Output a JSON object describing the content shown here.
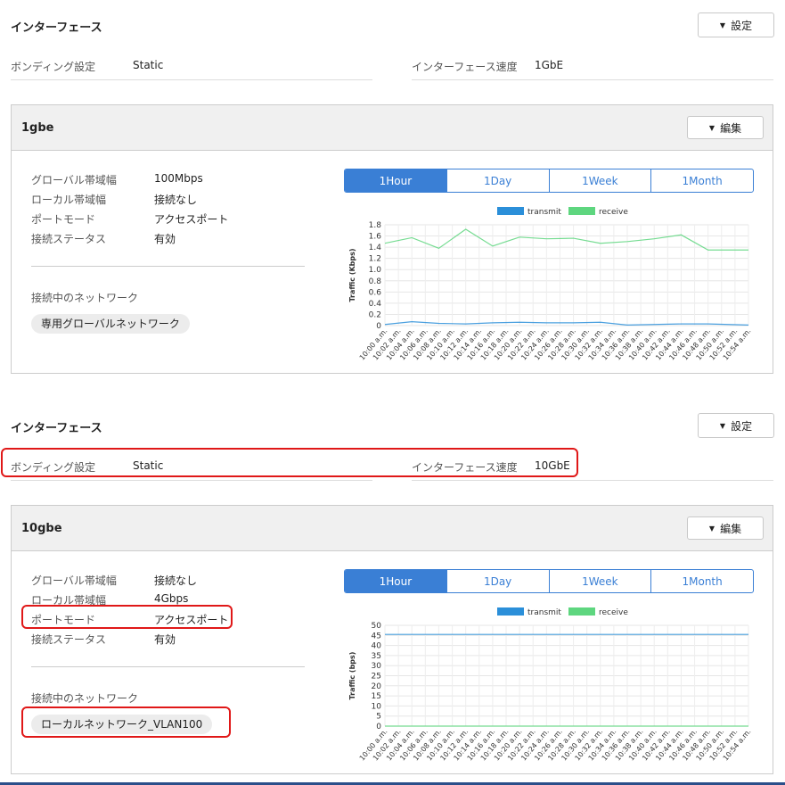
{
  "section1": {
    "title": "インターフェース",
    "settings_button": "設定",
    "bonding_label": "ボンディング設定",
    "bonding_value": "Static",
    "speed_label": "インターフェース速度",
    "speed_value": "1GbE"
  },
  "panel1": {
    "title": "1gbe",
    "edit_button": "編集",
    "rows": [
      {
        "label": "グローバル帯域幅",
        "value": "100Mbps"
      },
      {
        "label": "ローカル帯域幅",
        "value": "接続なし"
      },
      {
        "label": "ポートモード",
        "value": "アクセスポート"
      },
      {
        "label": "接続ステータス",
        "value": "有効"
      }
    ],
    "networks_label": "接続中のネットワーク",
    "network_chip": "専用グローバルネットワーク",
    "tabs": [
      "1Hour",
      "1Day",
      "1Week",
      "1Month"
    ],
    "active_tab": "1Hour"
  },
  "section2": {
    "title": "インターフェース",
    "settings_button": "設定",
    "bonding_label": "ボンディング設定",
    "bonding_value": "Static",
    "speed_label": "インターフェース速度",
    "speed_value": "10GbE"
  },
  "panel2": {
    "title": "10gbe",
    "edit_button": "編集",
    "rows": [
      {
        "label": "グローバル帯域幅",
        "value": "接続なし"
      },
      {
        "label": "ローカル帯域幅",
        "value": "4Gbps"
      },
      {
        "label": "ポートモード",
        "value": "アクセスポート"
      },
      {
        "label": "接続ステータス",
        "value": "有効"
      }
    ],
    "networks_label": "接続中のネットワーク",
    "network_chip": "ローカルネットワーク_VLAN100",
    "tabs": [
      "1Hour",
      "1Day",
      "1Week",
      "1Month"
    ],
    "active_tab": "1Hour"
  },
  "colors": {
    "accent": "#3a7fd5",
    "transmit": "#2b8fd9",
    "receive": "#5ed67f",
    "highlight": "#e01818"
  },
  "chart_data": [
    {
      "type": "line",
      "ylabel": "Traffic (Kbps)",
      "ylim": [
        0,
        1.8
      ],
      "yticks": [
        "0",
        "0.2",
        "0.4",
        "0.6",
        "0.8",
        "1.0",
        "1.2",
        "1.4",
        "1.6",
        "1.8"
      ],
      "x": [
        "10:00 a.m.",
        "10:02 a.m.",
        "10:04 a.m.",
        "10:06 a.m.",
        "10:08 a.m.",
        "10:10 a.m.",
        "10:12 a.m.",
        "10:14 a.m.",
        "10:16 a.m.",
        "10:18 a.m.",
        "10:20 a.m.",
        "10:22 a.m.",
        "10:24 a.m.",
        "10:26 a.m.",
        "10:28 a.m.",
        "10:30 a.m.",
        "10:32 a.m.",
        "10:34 a.m.",
        "10:36 a.m.",
        "10:38 a.m.",
        "10:40 a.m.",
        "10:42 a.m.",
        "10:44 a.m.",
        "10:46 a.m.",
        "10:48 a.m.",
        "10:50 a.m.",
        "10:52 a.m.",
        "10:54 a.m."
      ],
      "series": [
        {
          "name": "transmit",
          "color": "#2b8fd9",
          "points": [
            [
              0,
              0.02
            ],
            [
              2,
              0.07
            ],
            [
              4,
              0.04
            ],
            [
              6,
              0.03
            ],
            [
              8,
              0.05
            ],
            [
              10,
              0.06
            ],
            [
              12,
              0.05
            ],
            [
              14,
              0.05
            ],
            [
              16,
              0.06
            ],
            [
              18,
              0.01
            ],
            [
              20,
              0.02
            ],
            [
              22,
              0.03
            ],
            [
              24,
              0.03
            ],
            [
              27,
              0.01
            ]
          ]
        },
        {
          "name": "receive",
          "color": "#5ed67f",
          "points": [
            [
              0,
              1.47
            ],
            [
              2,
              1.57
            ],
            [
              4,
              1.38
            ],
            [
              6,
              1.72
            ],
            [
              8,
              1.42
            ],
            [
              10,
              1.58
            ],
            [
              12,
              1.55
            ],
            [
              14,
              1.56
            ],
            [
              16,
              1.47
            ],
            [
              18,
              1.5
            ],
            [
              20,
              1.55
            ],
            [
              22,
              1.62
            ],
            [
              24,
              1.35
            ],
            [
              27,
              1.35
            ]
          ]
        }
      ],
      "legend": "top",
      "grid": true
    },
    {
      "type": "line",
      "ylabel": "Traffic (bps)",
      "ylim": [
        0,
        50
      ],
      "yticks": [
        "0",
        "5",
        "10",
        "15",
        "20",
        "25",
        "30",
        "35",
        "40",
        "45",
        "50"
      ],
      "x": [
        "10:00 a.m.",
        "10:02 a.m.",
        "10:04 a.m.",
        "10:06 a.m.",
        "10:08 a.m.",
        "10:10 a.m.",
        "10:12 a.m.",
        "10:14 a.m.",
        "10:16 a.m.",
        "10:18 a.m.",
        "10:20 a.m.",
        "10:22 a.m.",
        "10:24 a.m.",
        "10:26 a.m.",
        "10:28 a.m.",
        "10:30 a.m.",
        "10:32 a.m.",
        "10:34 a.m.",
        "10:36 a.m.",
        "10:38 a.m.",
        "10:40 a.m.",
        "10:42 a.m.",
        "10:44 a.m.",
        "10:46 a.m.",
        "10:48 a.m.",
        "10:50 a.m.",
        "10:52 a.m.",
        "10:54 a.m."
      ],
      "series": [
        {
          "name": "transmit",
          "color": "#2b8fd9",
          "points": [
            [
              0,
              45.5
            ],
            [
              27,
              45.5
            ]
          ]
        },
        {
          "name": "receive",
          "color": "#5ed67f",
          "points": [
            [
              0,
              0
            ],
            [
              27,
              0
            ]
          ]
        }
      ],
      "legend": "top",
      "grid": true
    }
  ]
}
